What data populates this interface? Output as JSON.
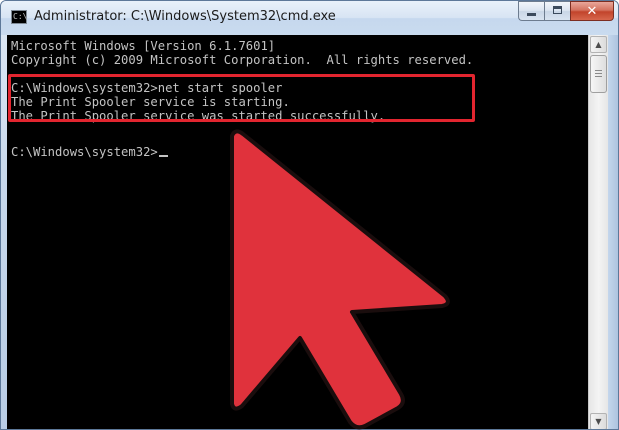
{
  "window": {
    "title": "Administrator: C:\\Windows\\System32\\cmd.exe",
    "icon": "cmd-icon",
    "icon_text": "C:\\",
    "controls": {
      "minimize_icon": "minimize-icon",
      "maximize_icon": "maximize-icon",
      "close_icon": "close-icon",
      "close_glyph": "✕"
    }
  },
  "console": {
    "lines": [
      "Microsoft Windows [Version 6.1.7601]",
      "Copyright (c) 2009 Microsoft Corporation.  All rights reserved.",
      "",
      "C:\\Windows\\system32>net start spooler",
      "The Print Spooler service is starting.",
      "The Print Spooler service was started successfully.",
      "",
      "C:\\Windows\\system32>"
    ],
    "text_color": "#c3c3c3",
    "background_color": "#000000"
  },
  "annotations": {
    "highlight_color": "#e2252f",
    "arrow_color": "#e0323c"
  },
  "scrollbar": {
    "up_glyph": "▲",
    "down_glyph": "▼"
  }
}
